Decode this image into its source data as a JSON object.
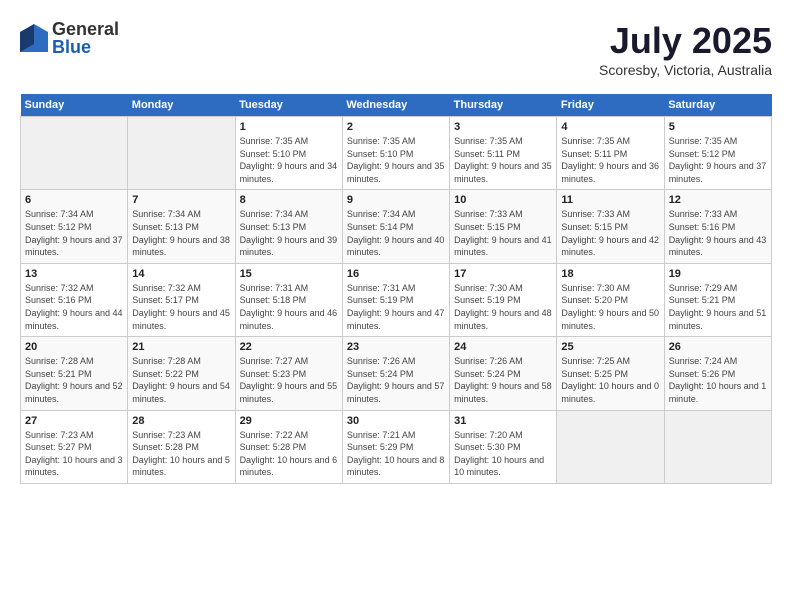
{
  "header": {
    "logo_general": "General",
    "logo_blue": "Blue",
    "month_title": "July 2025",
    "location": "Scoresby, Victoria, Australia"
  },
  "days_of_week": [
    "Sunday",
    "Monday",
    "Tuesday",
    "Wednesday",
    "Thursday",
    "Friday",
    "Saturday"
  ],
  "weeks": [
    [
      {
        "day": "",
        "empty": true
      },
      {
        "day": "",
        "empty": true
      },
      {
        "day": "1",
        "sunrise": "Sunrise: 7:35 AM",
        "sunset": "Sunset: 5:10 PM",
        "daylight": "Daylight: 9 hours and 34 minutes."
      },
      {
        "day": "2",
        "sunrise": "Sunrise: 7:35 AM",
        "sunset": "Sunset: 5:10 PM",
        "daylight": "Daylight: 9 hours and 35 minutes."
      },
      {
        "day": "3",
        "sunrise": "Sunrise: 7:35 AM",
        "sunset": "Sunset: 5:11 PM",
        "daylight": "Daylight: 9 hours and 35 minutes."
      },
      {
        "day": "4",
        "sunrise": "Sunrise: 7:35 AM",
        "sunset": "Sunset: 5:11 PM",
        "daylight": "Daylight: 9 hours and 36 minutes."
      },
      {
        "day": "5",
        "sunrise": "Sunrise: 7:35 AM",
        "sunset": "Sunset: 5:12 PM",
        "daylight": "Daylight: 9 hours and 37 minutes."
      }
    ],
    [
      {
        "day": "6",
        "sunrise": "Sunrise: 7:34 AM",
        "sunset": "Sunset: 5:12 PM",
        "daylight": "Daylight: 9 hours and 37 minutes."
      },
      {
        "day": "7",
        "sunrise": "Sunrise: 7:34 AM",
        "sunset": "Sunset: 5:13 PM",
        "daylight": "Daylight: 9 hours and 38 minutes."
      },
      {
        "day": "8",
        "sunrise": "Sunrise: 7:34 AM",
        "sunset": "Sunset: 5:13 PM",
        "daylight": "Daylight: 9 hours and 39 minutes."
      },
      {
        "day": "9",
        "sunrise": "Sunrise: 7:34 AM",
        "sunset": "Sunset: 5:14 PM",
        "daylight": "Daylight: 9 hours and 40 minutes."
      },
      {
        "day": "10",
        "sunrise": "Sunrise: 7:33 AM",
        "sunset": "Sunset: 5:15 PM",
        "daylight": "Daylight: 9 hours and 41 minutes."
      },
      {
        "day": "11",
        "sunrise": "Sunrise: 7:33 AM",
        "sunset": "Sunset: 5:15 PM",
        "daylight": "Daylight: 9 hours and 42 minutes."
      },
      {
        "day": "12",
        "sunrise": "Sunrise: 7:33 AM",
        "sunset": "Sunset: 5:16 PM",
        "daylight": "Daylight: 9 hours and 43 minutes."
      }
    ],
    [
      {
        "day": "13",
        "sunrise": "Sunrise: 7:32 AM",
        "sunset": "Sunset: 5:16 PM",
        "daylight": "Daylight: 9 hours and 44 minutes."
      },
      {
        "day": "14",
        "sunrise": "Sunrise: 7:32 AM",
        "sunset": "Sunset: 5:17 PM",
        "daylight": "Daylight: 9 hours and 45 minutes."
      },
      {
        "day": "15",
        "sunrise": "Sunrise: 7:31 AM",
        "sunset": "Sunset: 5:18 PM",
        "daylight": "Daylight: 9 hours and 46 minutes."
      },
      {
        "day": "16",
        "sunrise": "Sunrise: 7:31 AM",
        "sunset": "Sunset: 5:19 PM",
        "daylight": "Daylight: 9 hours and 47 minutes."
      },
      {
        "day": "17",
        "sunrise": "Sunrise: 7:30 AM",
        "sunset": "Sunset: 5:19 PM",
        "daylight": "Daylight: 9 hours and 48 minutes."
      },
      {
        "day": "18",
        "sunrise": "Sunrise: 7:30 AM",
        "sunset": "Sunset: 5:20 PM",
        "daylight": "Daylight: 9 hours and 50 minutes."
      },
      {
        "day": "19",
        "sunrise": "Sunrise: 7:29 AM",
        "sunset": "Sunset: 5:21 PM",
        "daylight": "Daylight: 9 hours and 51 minutes."
      }
    ],
    [
      {
        "day": "20",
        "sunrise": "Sunrise: 7:28 AM",
        "sunset": "Sunset: 5:21 PM",
        "daylight": "Daylight: 9 hours and 52 minutes."
      },
      {
        "day": "21",
        "sunrise": "Sunrise: 7:28 AM",
        "sunset": "Sunset: 5:22 PM",
        "daylight": "Daylight: 9 hours and 54 minutes."
      },
      {
        "day": "22",
        "sunrise": "Sunrise: 7:27 AM",
        "sunset": "Sunset: 5:23 PM",
        "daylight": "Daylight: 9 hours and 55 minutes."
      },
      {
        "day": "23",
        "sunrise": "Sunrise: 7:26 AM",
        "sunset": "Sunset: 5:24 PM",
        "daylight": "Daylight: 9 hours and 57 minutes."
      },
      {
        "day": "24",
        "sunrise": "Sunrise: 7:26 AM",
        "sunset": "Sunset: 5:24 PM",
        "daylight": "Daylight: 9 hours and 58 minutes."
      },
      {
        "day": "25",
        "sunrise": "Sunrise: 7:25 AM",
        "sunset": "Sunset: 5:25 PM",
        "daylight": "Daylight: 10 hours and 0 minutes."
      },
      {
        "day": "26",
        "sunrise": "Sunrise: 7:24 AM",
        "sunset": "Sunset: 5:26 PM",
        "daylight": "Daylight: 10 hours and 1 minute."
      }
    ],
    [
      {
        "day": "27",
        "sunrise": "Sunrise: 7:23 AM",
        "sunset": "Sunset: 5:27 PM",
        "daylight": "Daylight: 10 hours and 3 minutes."
      },
      {
        "day": "28",
        "sunrise": "Sunrise: 7:23 AM",
        "sunset": "Sunset: 5:28 PM",
        "daylight": "Daylight: 10 hours and 5 minutes."
      },
      {
        "day": "29",
        "sunrise": "Sunrise: 7:22 AM",
        "sunset": "Sunset: 5:28 PM",
        "daylight": "Daylight: 10 hours and 6 minutes."
      },
      {
        "day": "30",
        "sunrise": "Sunrise: 7:21 AM",
        "sunset": "Sunset: 5:29 PM",
        "daylight": "Daylight: 10 hours and 8 minutes."
      },
      {
        "day": "31",
        "sunrise": "Sunrise: 7:20 AM",
        "sunset": "Sunset: 5:30 PM",
        "daylight": "Daylight: 10 hours and 10 minutes."
      },
      {
        "day": "",
        "empty": true
      },
      {
        "day": "",
        "empty": true
      }
    ]
  ]
}
